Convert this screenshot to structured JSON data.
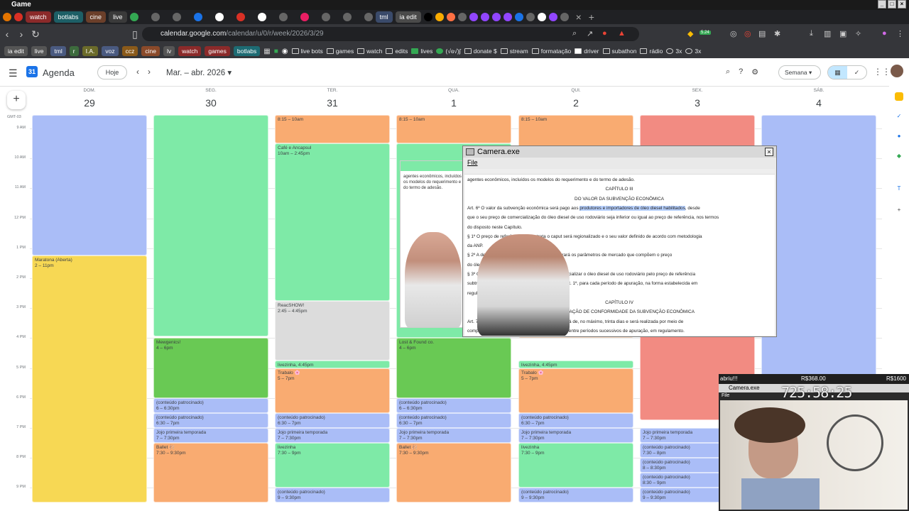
{
  "window": {
    "title": "Game"
  },
  "tabs": [
    {
      "label": "watch",
      "color": "#8b2a2a"
    },
    {
      "label": "botlabs",
      "color": "#1d5f66"
    },
    {
      "label": "cine",
      "color": "#6b3f2a"
    },
    {
      "label": "live",
      "color": "#3a3a3a"
    },
    {
      "label": "tml",
      "color": "#3a4a6a"
    },
    {
      "label": "ia edit",
      "color": "#4a4a4a"
    }
  ],
  "browser": {
    "url_host": "calendar.google.com",
    "url_path": "/calendar/u/0/r/week/2026/3/29",
    "extension_badge": "5.24"
  },
  "bookmarks": {
    "chips": [
      {
        "label": "ia edit",
        "color": "#555"
      },
      {
        "label": "live",
        "color": "#555"
      },
      {
        "label": "tml",
        "color": "#4a5a80"
      },
      {
        "label": "r",
        "color": "#3d6b3d"
      },
      {
        "label": "I.A.",
        "color": "#6b6b2a"
      },
      {
        "label": "voz",
        "color": "#4a5a80"
      },
      {
        "label": "ccz",
        "color": "#8a5a1a"
      },
      {
        "label": "cine",
        "color": "#8a4a2a"
      },
      {
        "label": "lv",
        "color": "#555"
      },
      {
        "label": "watch",
        "color": "#8b2a2a"
      },
      {
        "label": "games",
        "color": "#8b2a2a"
      },
      {
        "label": "botlabs",
        "color": "#1d6b73"
      }
    ],
    "folders": [
      "live bots",
      "games",
      "watch",
      "edits",
      "lives",
      "(√ɞ√)ʃ",
      "donate $",
      "stream",
      "formatação",
      "driver",
      "subathon",
      "rádio",
      "3x",
      "3x"
    ]
  },
  "calendar": {
    "app_name": "Agenda",
    "today_button": "Hoje",
    "date_range": "Mar. – abr. 2026",
    "view_button": "Semana",
    "timezone": "GMT-03",
    "days": [
      {
        "name": "DOM.",
        "num": "29"
      },
      {
        "name": "SEG.",
        "num": "30"
      },
      {
        "name": "TER.",
        "num": "31"
      },
      {
        "name": "QUA.",
        "num": "1"
      },
      {
        "name": "QUI.",
        "num": "2"
      },
      {
        "name": "SEX.",
        "num": "3"
      },
      {
        "name": "SÁB.",
        "num": "4"
      }
    ],
    "hours": [
      "9 AM",
      "10 AM",
      "11 AM",
      "12 PM",
      "1 PM",
      "2 PM",
      "3 PM",
      "4 PM",
      "5 PM",
      "6 PM",
      "7 PM",
      "8 PM",
      "9 PM"
    ],
    "events": [
      {
        "day": 0,
        "start": 8,
        "end": 13.25,
        "title": "",
        "time": "",
        "color": "#aabdf7"
      },
      {
        "day": 0,
        "start": 13.25,
        "end": 21.5,
        "title": "Maratona (Aberta)",
        "time": "2 – 11pm",
        "color": "#f7d854"
      },
      {
        "day": 1,
        "start": 8,
        "end": 15.95,
        "title": "",
        "time": "",
        "color": "#7eeaa7"
      },
      {
        "day": 1,
        "start": 16,
        "end": 18,
        "title": "Mewgenics!",
        "time": "4 – 6pm",
        "color": "#69c954"
      },
      {
        "day": 1,
        "start": 18,
        "end": 18.5,
        "title": "(conteúdo patrocinado)",
        "time": "6 – 6:30pm",
        "color": "#aabdf7"
      },
      {
        "day": 1,
        "start": 18.5,
        "end": 19,
        "title": "(conteúdo patrocinado)",
        "time": "6:30 – 7pm",
        "color": "#aabdf7"
      },
      {
        "day": 1,
        "start": 19,
        "end": 19.5,
        "title": "Jojo primeira temporada",
        "time": "7 – 7:30pm",
        "color": "#aabdf7"
      },
      {
        "day": 1,
        "start": 19.5,
        "end": 21.5,
        "title": "Ballet 🩰",
        "time": "7:30 – 9:30pm",
        "color": "#f9ab71"
      },
      {
        "day": 2,
        "start": 8,
        "end": 9.5,
        "title": "",
        "time": "8:15 – 10am",
        "color": "#f9ab71"
      },
      {
        "day": 2,
        "start": 9.5,
        "end": 14.75,
        "title": "Café e Ancapsul",
        "time": "10am – 2:45pm",
        "color": "#7eeaa7"
      },
      {
        "day": 2,
        "start": 14.75,
        "end": 16.75,
        "title": "ReacSHOW!",
        "time": "2:45 – 4:45pm",
        "color": "#dcdcdc"
      },
      {
        "day": 2,
        "start": 16.75,
        "end": 17,
        "title": "livezinha, 4:45pm",
        "time": "",
        "color": "#7eeaa7"
      },
      {
        "day": 2,
        "start": 17,
        "end": 18.5,
        "title": "Trabalo 🌸",
        "time": "5 – 7pm",
        "color": "#f9ab71"
      },
      {
        "day": 2,
        "start": 18.5,
        "end": 19,
        "title": "(conteúdo patrocinado)",
        "time": "6:30 – 7pm",
        "color": "#aabdf7"
      },
      {
        "day": 2,
        "start": 19,
        "end": 19.5,
        "title": "Jojo primeira temporada",
        "time": "7 – 7:30pm",
        "color": "#aabdf7"
      },
      {
        "day": 2,
        "start": 19.5,
        "end": 21,
        "title": "livezinha",
        "time": "7:30 – 9pm",
        "color": "#7eeaa7"
      },
      {
        "day": 2,
        "start": 21,
        "end": 21.5,
        "title": "(conteúdo patrocinado)",
        "time": "9 – 9:30pm",
        "color": "#aabdf7"
      },
      {
        "day": 3,
        "start": 8,
        "end": 9.5,
        "title": "",
        "time": "8:15 – 10am",
        "color": "#f9ab71"
      },
      {
        "day": 3,
        "start": 9.5,
        "end": 16,
        "title": "",
        "time": "",
        "color": "#7eeaa7"
      },
      {
        "day": 3,
        "start": 16,
        "end": 18,
        "title": "Lost & Found co.",
        "time": "4 – 6pm",
        "color": "#69c954"
      },
      {
        "day": 3,
        "start": 18,
        "end": 18.5,
        "title": "(conteúdo patrocinado)",
        "time": "6 – 6:30pm",
        "color": "#aabdf7"
      },
      {
        "day": 3,
        "start": 18.5,
        "end": 19,
        "title": "(conteúdo patrocinado)",
        "time": "6:30 – 7pm",
        "color": "#aabdf7"
      },
      {
        "day": 3,
        "start": 19,
        "end": 19.5,
        "title": "Jojo primeira temporada",
        "time": "7 – 7:30pm",
        "color": "#aabdf7"
      },
      {
        "day": 3,
        "start": 19.5,
        "end": 21.5,
        "title": "Ballet 🩰",
        "time": "7:30 – 9:30pm",
        "color": "#f9ab71"
      },
      {
        "day": 4,
        "start": 8,
        "end": 16,
        "title": "",
        "time": "8:15 – 10am",
        "color": "#f9ab71"
      },
      {
        "day": 4,
        "start": 16.75,
        "end": 17,
        "title": "livezinha, 4:45pm",
        "time": "",
        "color": "#7eeaa7"
      },
      {
        "day": 4,
        "start": 17,
        "end": 18.5,
        "title": "Trabalo 🌸",
        "time": "5 – 7pm",
        "color": "#f9ab71"
      },
      {
        "day": 4,
        "start": 18.5,
        "end": 19,
        "title": "(conteúdo patrocinado)",
        "time": "6:30 – 7pm",
        "color": "#aabdf7"
      },
      {
        "day": 4,
        "start": 19,
        "end": 19.5,
        "title": "Jojo primeira temporada",
        "time": "7 – 7:30pm",
        "color": "#aabdf7"
      },
      {
        "day": 4,
        "start": 19.5,
        "end": 21,
        "title": "livezinha",
        "time": "7:30 – 9pm",
        "color": "#7eeaa7"
      },
      {
        "day": 4,
        "start": 21,
        "end": 21.5,
        "title": "(conteúdo patrocinado)",
        "time": "9 – 9:30pm",
        "color": "#aabdf7"
      },
      {
        "day": 5,
        "start": 8,
        "end": 18.75,
        "title": "",
        "time": "",
        "color": "#f28b82"
      },
      {
        "day": 5,
        "start": 19,
        "end": 19.5,
        "title": "Jojo primeira temporada",
        "time": "7 – 7:30pm",
        "color": "#aabdf7"
      },
      {
        "day": 5,
        "start": 19.5,
        "end": 20,
        "title": "(conteúdo patrocinado)",
        "time": "7:30 – 8pm",
        "color": "#aabdf7"
      },
      {
        "day": 5,
        "start": 20,
        "end": 20.5,
        "title": "(conteúdo patrocinado)",
        "time": "8 – 8:30pm",
        "color": "#aabdf7"
      },
      {
        "day": 5,
        "start": 20.5,
        "end": 21,
        "title": "(conteúdo patrocinado)",
        "time": "8:30 – 9pm",
        "color": "#aabdf7"
      },
      {
        "day": 5,
        "start": 21,
        "end": 21.5,
        "title": "(conteúdo patrocinado)",
        "time": "9 – 9:30pm",
        "color": "#aabdf7"
      },
      {
        "day": 6,
        "start": 8,
        "end": 21.5,
        "title": "",
        "time": "",
        "color": "#aabdf7"
      }
    ]
  },
  "camera_window": {
    "title": "Camera.exe",
    "menu": "File",
    "doc_lines": [
      {
        "text": "agentes econômicos, incluídos os modelos do requerimento e do termo de adesão.",
        "center": false
      },
      {
        "text": "CAPÍTULO III",
        "center": true
      },
      {
        "text": "DO VALOR DA SUBVENÇÃO ECONÔMICA",
        "center": true
      },
      {
        "text": "Art. 6º O valor da subvenção econômica será pago aos produtores e importadores de óleo diesel habilitados, desde",
        "center": false
      },
      {
        "text": "que o seu preço de comercialização do óleo diesel de uso rodoviário seja inferior ou igual ao preço de referência, nos termos",
        "center": false
      },
      {
        "text": "do disposto neste Capítulo.",
        "center": false
      },
      {
        "text": "§ 1º O preço de referência de que trata o caput será regionalizado e o seu valor definido de acordo com metodologia",
        "center": false
      },
      {
        "text": "da ANP.",
        "center": false
      },
      {
        "text": "§ 2º A definição do preço de referência considerará os parâmetros de mercado que compõem o preço",
        "center": false
      },
      {
        "text": "do óleo diesel rodoviário.",
        "center": false
      },
      {
        "text": "§ 3º O agente econômico habilitado deverá comercializar o óleo diesel de uso rodoviário pelo preço de referência",
        "center": false
      },
      {
        "text": "subtraído o valor da subvenção estabelecido no art. 1º, para cada período de apuração, na forma estabelecida em",
        "center": false
      },
      {
        "text": "regulamento.",
        "center": false
      },
      {
        "text": "CAPÍTULO IV",
        "center": true
      },
      {
        "text": "DA VERIFICAÇÃO DE CONFORMIDADE DA SUBVENÇÃO ECONÔMICA",
        "center": true
      },
      {
        "text": "Art. 7º O pagamento da subvenção econômica será de, no máximo, trinta dias e será realizada por meio de",
        "center": false
      },
      {
        "text": "compensação de diferenças positivas e negativas entre períodos sucessivos de apuração, em regulamento.",
        "center": false
      }
    ],
    "highlight": "produtores e importadores de óleo diesel habilitados"
  },
  "stream_overlay": {
    "label_left": "abriu!!!",
    "label_mid": "R$368.00",
    "label_right": "R$1600",
    "camera_title": "Camera.exe",
    "timer": "725:58:25",
    "menu": "File"
  }
}
